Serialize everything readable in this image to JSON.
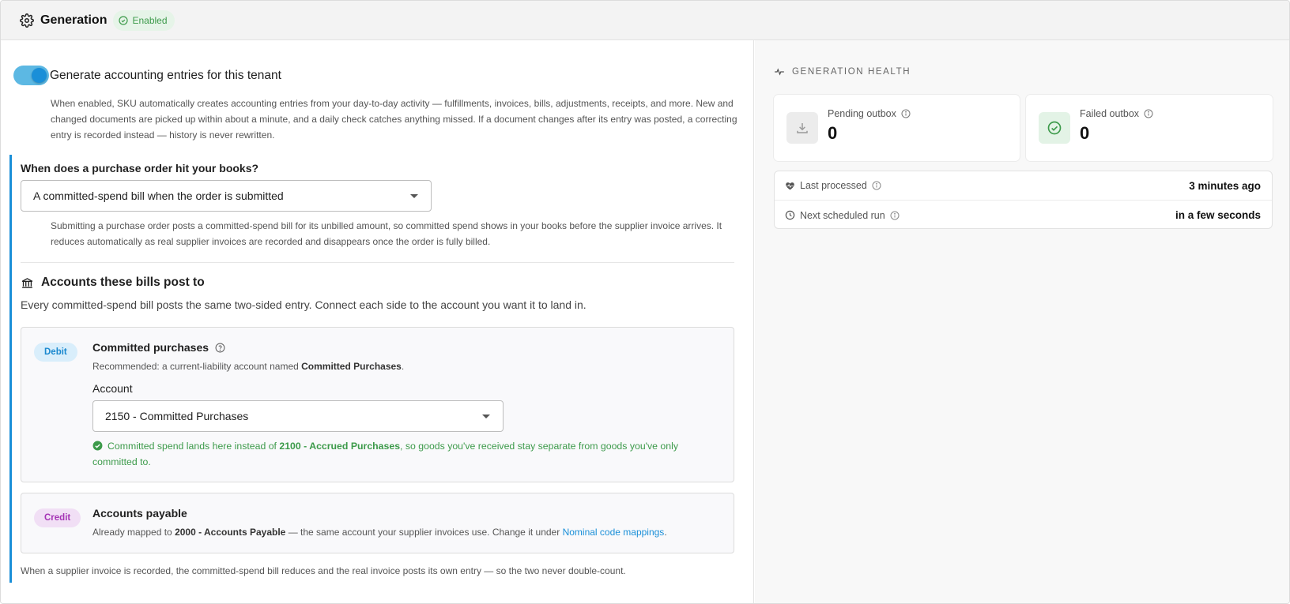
{
  "header": {
    "title": "Generation",
    "status_badge": "Enabled",
    "icon": "gear-icon"
  },
  "toggle": {
    "label": "Generate accounting entries for this tenant",
    "on": true,
    "description": "When enabled, SKU automatically creates accounting entries from your day-to-day activity — fulfillments, invoices, bills, adjustments, receipts, and more. New and changed documents are picked up within about a minute, and a daily check catches anything missed. If a document changes after its entry was posted, a correcting entry is recorded instead — history is never rewritten."
  },
  "purchase_order": {
    "question": "When does a purchase order hit your books?",
    "selected": "A committed-spend bill when the order is submitted",
    "description": "Submitting a purchase order posts a committed-spend bill for its unbilled amount, so committed spend shows in your books before the supplier invoice arrives. It reduces automatically as real supplier invoices are recorded and disappears once the order is fully billed."
  },
  "accounts": {
    "title": "Accounts these bills post to",
    "subtitle": "Every committed-spend bill posts the same two-sided entry. Connect each side to the account you want it to land in.",
    "debit": {
      "pill": "Debit",
      "title": "Committed purchases",
      "rec_prefix": "Recommended: a current-liability account named ",
      "rec_bold": "Committed Purchases",
      "rec_suffix": ".",
      "account_label": "Account",
      "account_value": "2150 - Committed Purchases",
      "note_prefix": "Committed spend lands here instead of ",
      "note_bold": "2100 - Accrued Purchases",
      "note_suffix": ", so goods you've received stay separate from goods you've only committed to."
    },
    "credit": {
      "pill": "Credit",
      "title": "Accounts payable",
      "desc_prefix": "Already mapped to ",
      "desc_bold": "2000 - Accounts Payable",
      "desc_mid": " — the same account your supplier invoices use. Change it under ",
      "desc_link": "Nominal code mappings",
      "desc_suffix": "."
    },
    "footer": "When a supplier invoice is recorded, the committed-spend bill reduces and the real invoice posts its own entry — so the two never double-count."
  },
  "health": {
    "title": "GENERATION HEALTH",
    "pending": {
      "label": "Pending outbox",
      "value": "0",
      "icon": "download-icon"
    },
    "failed": {
      "label": "Failed outbox",
      "value": "0",
      "icon": "check-circle-icon"
    },
    "last_processed": {
      "label": "Last processed",
      "value": "3 minutes ago",
      "icon": "heart-pulse-icon"
    },
    "next_run": {
      "label": "Next scheduled run",
      "value": "in a few seconds",
      "icon": "clock-icon"
    }
  },
  "colors": {
    "accent": "#1a8fd8",
    "success": "#3c9a4a",
    "debit_pill": "#d9eefb",
    "credit_pill": "#f1dff5"
  }
}
